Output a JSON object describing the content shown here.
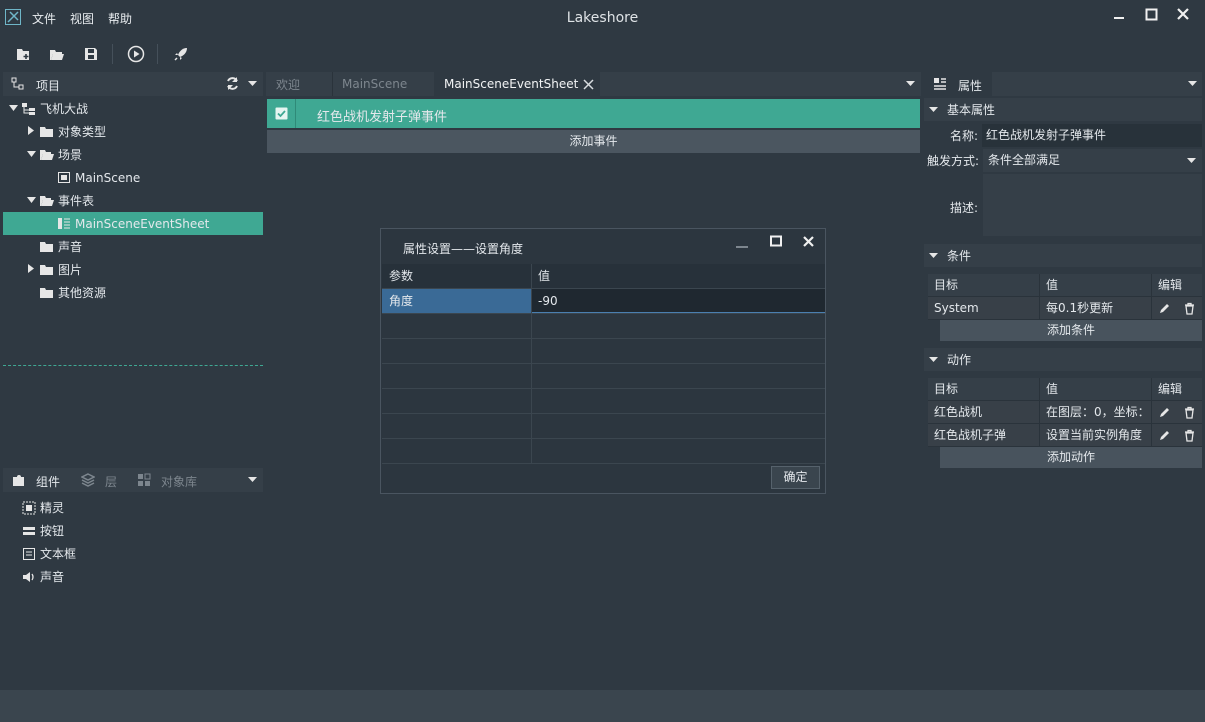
{
  "app": {
    "title": "Lakeshore",
    "menu": [
      "文件",
      "视图",
      "帮助"
    ]
  },
  "toolbar": {
    "buttons": [
      "new-project-icon",
      "open-folder-icon",
      "save-icon",
      "play-icon",
      "rocket-icon"
    ]
  },
  "project_panel": {
    "title": "项目",
    "tree": [
      {
        "label": "飞机大战",
        "level": 0,
        "expanded": true,
        "icon": "project-icon"
      },
      {
        "label": "对象类型",
        "level": 1,
        "expanded": false,
        "icon": "folder-icon"
      },
      {
        "label": "场景",
        "level": 1,
        "expanded": true,
        "icon": "folder-open-icon"
      },
      {
        "label": "MainScene",
        "level": 2,
        "icon": "scene-icon"
      },
      {
        "label": "事件表",
        "level": 1,
        "expanded": true,
        "icon": "folder-open-icon"
      },
      {
        "label": "MainSceneEventSheet",
        "level": 2,
        "icon": "eventsheet-icon",
        "selected": true
      },
      {
        "label": "声音",
        "level": 1,
        "icon": "folder-icon"
      },
      {
        "label": "图片",
        "level": 1,
        "expanded": false,
        "icon": "folder-icon"
      },
      {
        "label": "其他资源",
        "level": 1,
        "icon": "folder-icon"
      }
    ]
  },
  "component_panel": {
    "tabs": [
      "组件",
      "层",
      "对象库"
    ],
    "items": [
      "精灵",
      "按钮",
      "文本框",
      "声音"
    ]
  },
  "editor": {
    "tabs": [
      "欢迎",
      "MainScene",
      "MainSceneEventSheet"
    ],
    "event_title": "红色战机发射子弹事件",
    "add_event_label": "添加事件"
  },
  "dialog": {
    "title": "属性设置——设置角度",
    "col_param": "参数",
    "col_value": "值",
    "param_name": "角度",
    "param_value": "-90",
    "ok_label": "确定"
  },
  "properties": {
    "title": "属性",
    "basic_section": "基本属性",
    "name_label": "名称:",
    "name_value": "红色战机发射子弹事件",
    "trigger_label": "触发方式:",
    "trigger_value": "条件全部满足",
    "desc_label": "描述:",
    "conditions_section": "条件",
    "actions_section": "动作",
    "col_target": "目标",
    "col_value": "值",
    "col_edit": "编辑",
    "conditions": [
      {
        "target": "System",
        "value": "每0.1秒更新"
      }
    ],
    "add_condition_label": "添加条件",
    "actions": [
      {
        "target": "红色战机",
        "value": "在图层：0，坐标："
      },
      {
        "target": "红色战机子弹",
        "value": "设置当前实例角度"
      }
    ],
    "add_action_label": "添加动作"
  },
  "colors": {
    "accent": "#3fa893",
    "background": "#2f3942",
    "selection": "#3a6a96"
  }
}
